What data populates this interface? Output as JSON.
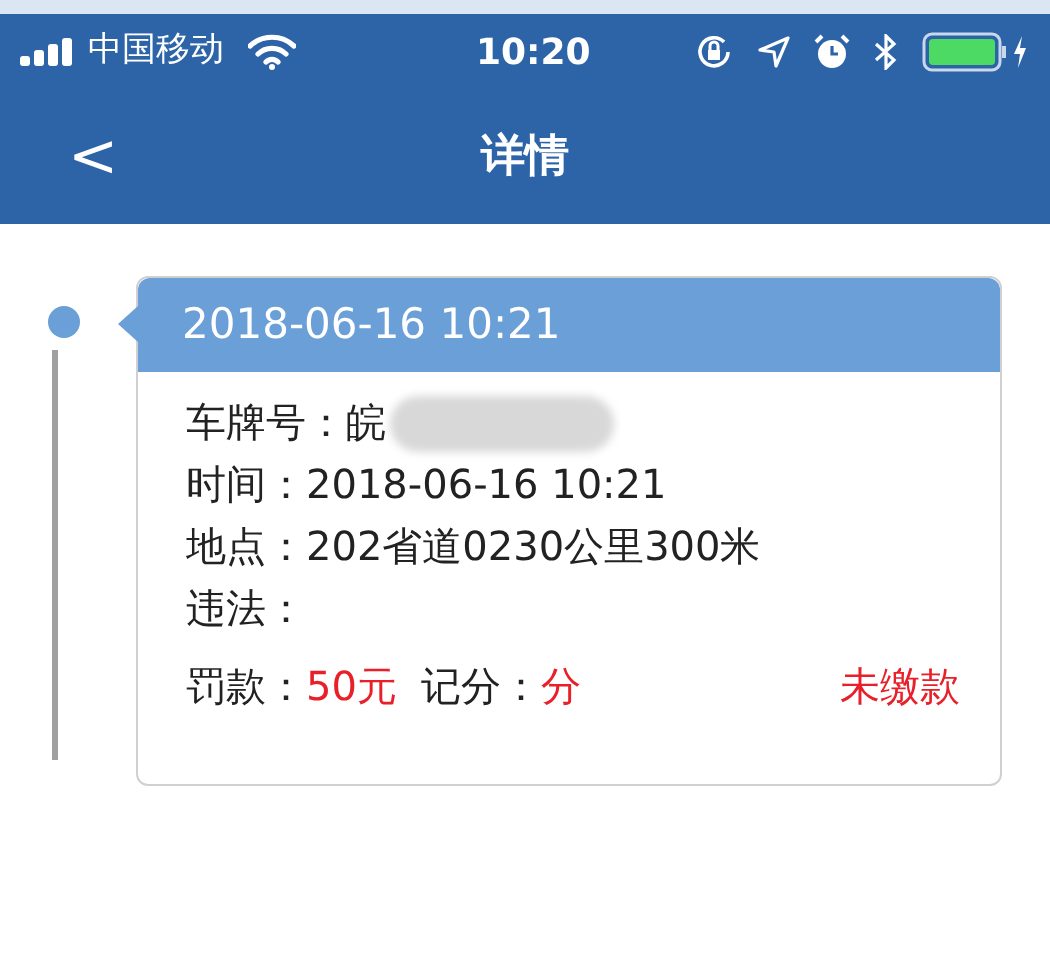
{
  "status_bar": {
    "carrier": "中国移动",
    "time": "10:20"
  },
  "nav": {
    "back": "<",
    "title": "详情"
  },
  "records": [
    {
      "header": "2018-06-16 10:21",
      "fields": [
        {
          "label": "车牌号：",
          "value": "皖",
          "kind": "plate"
        },
        {
          "label": "时间：",
          "value": "2018-06-16 10:21",
          "kind": "text"
        },
        {
          "label": "地点：",
          "value": "202省道0230公里300米",
          "kind": "text"
        },
        {
          "label": "违法：",
          "kind": "text"
        }
      ],
      "fine_label": "罚款：",
      "fine": "50元",
      "points_label": "记分：",
      "points": "分",
      "payment_status": "未缴款"
    }
  ]
}
